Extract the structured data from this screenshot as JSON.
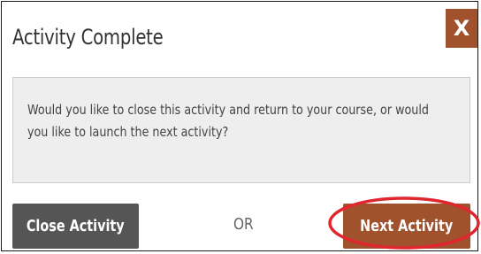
{
  "dialog": {
    "title": "Activity Complete",
    "close_icon_text": "X",
    "message": "Would you like to close this activity and return to your course, or would you like to launch the next activity?",
    "buttons": {
      "close_label": "Close Activity",
      "separator": "OR",
      "next_label": "Next Activity"
    }
  },
  "colors": {
    "accent": "#a0522d",
    "secondary_button": "#555555",
    "message_background": "#eeeeee",
    "annotation_highlight": "#e0262f"
  }
}
